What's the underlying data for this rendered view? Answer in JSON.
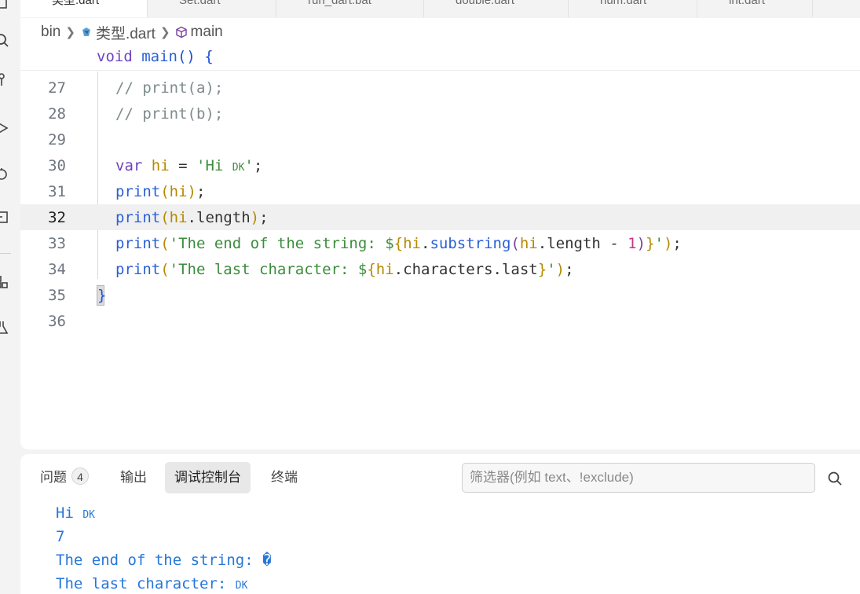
{
  "tabs": [
    {
      "label": "类型.dart",
      "active": true
    },
    {
      "label": "Set.dart",
      "active": false
    },
    {
      "label": "run_dart.bat",
      "active": false
    },
    {
      "label": "double.dart",
      "active": false
    },
    {
      "label": "num.dart",
      "active": false
    },
    {
      "label": "int.dart",
      "active": false
    }
  ],
  "breadcrumb": {
    "folder": "bin",
    "file": "类型.dart",
    "symbol": "main"
  },
  "sticky": {
    "keyword": "void",
    "fn": "main",
    "rest": "() {"
  },
  "code": {
    "lines": [
      {
        "num": "27"
      },
      {
        "num": "28"
      },
      {
        "num": "29"
      },
      {
        "num": "30"
      },
      {
        "num": "31"
      },
      {
        "num": "32"
      },
      {
        "num": "33"
      },
      {
        "num": "34"
      },
      {
        "num": "35"
      },
      {
        "num": "36"
      }
    ],
    "l27": {
      "comment": "// print(a);"
    },
    "l28": {
      "comment": "// print(b);"
    },
    "l30": {
      "kw": "var",
      "name": "hi",
      "eq": " = ",
      "str": "'Hi ",
      "str_sc": "dk",
      "str_end": "'",
      "semi": ";"
    },
    "l31": {
      "fn": "print",
      "open": "(",
      "arg": "hi",
      "close": ")",
      "semi": ";"
    },
    "l32": {
      "fn": "print",
      "open": "(",
      "arg": "hi",
      "dot": ".",
      "prop": "length",
      "close": ")",
      "semi": ";"
    },
    "l33": {
      "fn": "print",
      "open": "(",
      "str": "'The end of the string: $",
      "ob": "{",
      "a": "hi",
      "d1": ".",
      "m": "substring",
      "p1": "(",
      "b": "hi",
      "d2": ".",
      "len": "length",
      "minus": " - ",
      "one": "1",
      "p2": ")",
      "cb": "}",
      "str_end": "'",
      "close": ")",
      "semi": ";"
    },
    "l34": {
      "fn": "print",
      "open": "(",
      "str": "'The last character: $",
      "ob": "{",
      "a": "hi",
      "d1": ".",
      "chars": "characters",
      "d2": ".",
      "last": "last",
      "cb": "}",
      "str_end": "'",
      "close": ")",
      "semi": ";"
    },
    "l35": {
      "brace": "}"
    }
  },
  "panel": {
    "tabs": {
      "problems": "问题",
      "problems_count": "4",
      "output": "输出",
      "debug_console": "调试控制台",
      "terminal": "终端"
    },
    "filter_placeholder": "筛选器(例如 text、!exclude)",
    "output_lines": [
      {
        "text": "Hi ",
        "sc": "dk"
      },
      {
        "text": "7"
      },
      {
        "text": "The end of the string: �"
      },
      {
        "text": "The last character: ",
        "sc": "dk"
      }
    ]
  },
  "colors": {
    "accent": "#2677d9",
    "keyword": "#6f42c1",
    "string": "#3c8c3c",
    "variable": "#b58900"
  }
}
